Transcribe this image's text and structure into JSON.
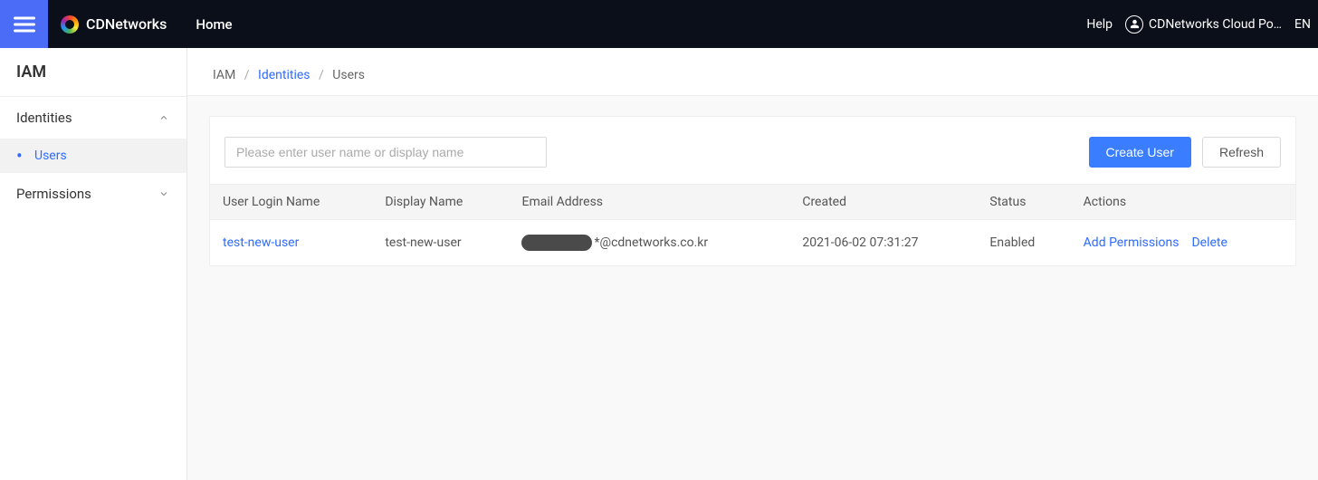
{
  "header": {
    "brand": "CDNetworks",
    "home": "Home",
    "help": "Help",
    "account": "CDNetworks Cloud Po…",
    "lang": "EN"
  },
  "sidebar": {
    "title": "IAM",
    "groups": [
      {
        "label": "Identities",
        "expanded": true,
        "items": [
          {
            "label": "Users",
            "active": true
          }
        ]
      },
      {
        "label": "Permissions",
        "expanded": false,
        "items": []
      }
    ]
  },
  "breadcrumb": {
    "root": "IAM",
    "mid": "Identities",
    "leaf": "Users"
  },
  "toolbar": {
    "search_placeholder": "Please enter user name or display name",
    "create_label": "Create User",
    "refresh_label": "Refresh"
  },
  "table": {
    "headers": {
      "login": "User Login Name",
      "display": "Display Name",
      "email": "Email Address",
      "created": "Created",
      "status": "Status",
      "actions": "Actions"
    },
    "rows": [
      {
        "login": "test-new-user",
        "display": "test-new-user",
        "email_suffix": "*@cdnetworks.co.kr",
        "created": "2021-06-02 07:31:27",
        "status": "Enabled",
        "action_add": "Add Permissions",
        "action_delete": "Delete"
      }
    ]
  }
}
